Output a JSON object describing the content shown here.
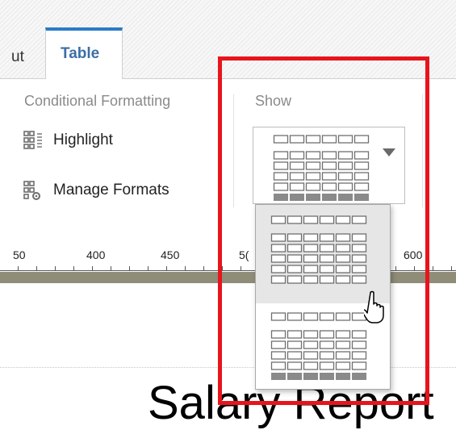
{
  "tabs": {
    "partial_label": "ut",
    "active_label": "Table"
  },
  "ribbon": {
    "conditional_formatting": {
      "title": "Conditional Formatting",
      "highlight_label": "Highlight",
      "manage_formats_label": "Manage Formats"
    },
    "show": {
      "title": "Show",
      "selected_option": "table-grid-with-totals",
      "options": [
        {
          "name": "table-grid-plain"
        },
        {
          "name": "table-grid-with-totals"
        }
      ]
    }
  },
  "ruler": {
    "labels": [
      "50",
      "400",
      "450",
      "5(",
      "600"
    ]
  },
  "canvas": {
    "report_title": "Salary Report"
  },
  "colors": {
    "accent": "#2b7bc6",
    "highlight_border": "#e8141c",
    "totals_cell": "#8a8a8a"
  }
}
